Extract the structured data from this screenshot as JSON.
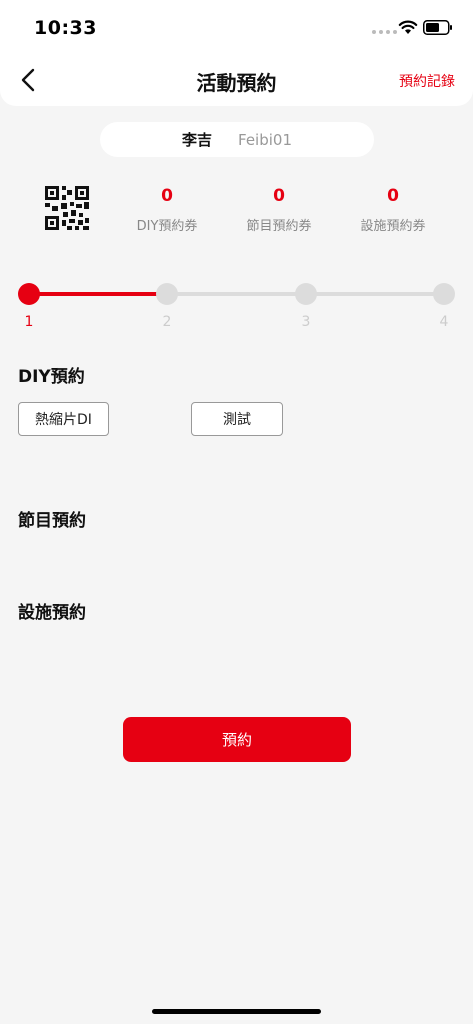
{
  "status_bar": {
    "time": "10:33"
  },
  "header": {
    "title": "活動預約",
    "records_label": "預約記錄"
  },
  "user": {
    "name": "李吉",
    "id": "Feibi01"
  },
  "coupons": [
    {
      "count": "0",
      "label": "DIY預約券"
    },
    {
      "count": "0",
      "label": "節目預約券"
    },
    {
      "count": "0",
      "label": "設施預約券"
    }
  ],
  "steps": {
    "labels": [
      "1",
      "2",
      "3",
      "4"
    ],
    "current": 1,
    "progress_fraction": 0.333
  },
  "sections": {
    "diy": {
      "title": "DIY預約",
      "options": [
        "熱縮片DI",
        "測試"
      ]
    },
    "program": {
      "title": "節目預約"
    },
    "facility": {
      "title": "設施預約"
    }
  },
  "submit_label": "預約",
  "colors": {
    "accent": "#e60012",
    "inactive": "#dcdcdc"
  },
  "icons": [
    "back-chevron-icon",
    "wifi-icon",
    "battery-icon",
    "qr-code-icon"
  ]
}
